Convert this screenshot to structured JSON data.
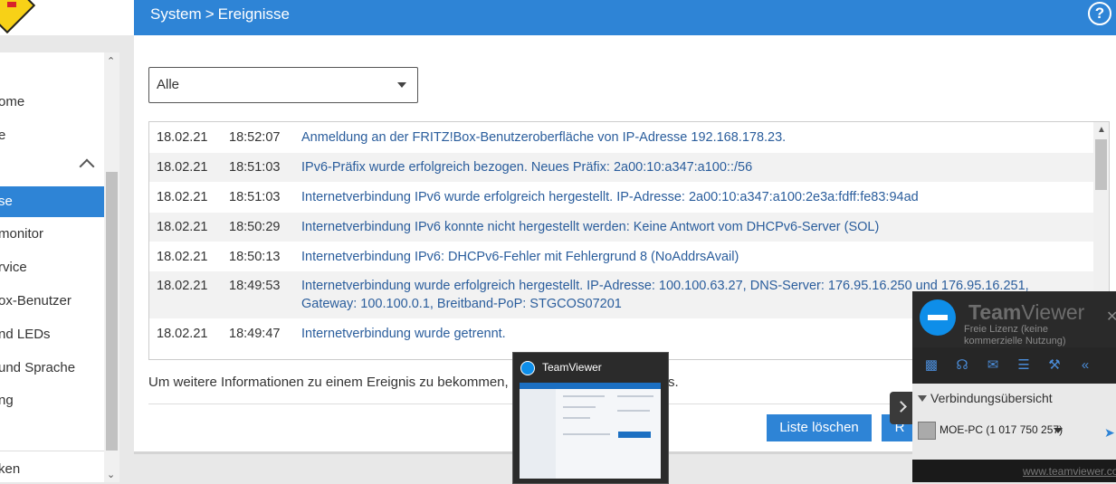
{
  "header": {
    "breadcrumb": [
      "System",
      "Ereignisse"
    ],
    "breadcrumb_separator": ">",
    "help_label": "?"
  },
  "sidebar": {
    "items": [
      {
        "label": "ome"
      },
      {
        "label": "e"
      },
      {
        "label": "se",
        "active": true
      },
      {
        "label": "monitor"
      },
      {
        "label": "rvice"
      },
      {
        "label": "ox-Benutzer"
      },
      {
        "label": "nd LEDs"
      },
      {
        "label": "und Sprache"
      },
      {
        "label": "ng"
      },
      {
        "label": "ken"
      }
    ]
  },
  "filter": {
    "selected": "Alle"
  },
  "events": [
    {
      "date": "18.02.21",
      "time": "18:52:07",
      "message": "Anmeldung an der FRITZ!Box-Benutzeroberfläche von IP-Adresse 192.168.178.23."
    },
    {
      "date": "18.02.21",
      "time": "18:51:03",
      "message": "IPv6-Präfix wurde erfolgreich bezogen. Neues Präfix: 2a00:10:a347:a100::/56"
    },
    {
      "date": "18.02.21",
      "time": "18:51:03",
      "message": "Internetverbindung IPv6 wurde erfolgreich hergestellt. IP-Adresse: 2a00:10:a347:a100:2e3a:fdff:fe83:94ad"
    },
    {
      "date": "18.02.21",
      "time": "18:50:29",
      "message": "Internetverbindung IPv6 konnte nicht hergestellt werden: Keine Antwort vom DHCPv6-Server (SOL)"
    },
    {
      "date": "18.02.21",
      "time": "18:50:13",
      "message": "Internetverbindung IPv6: DHCPv6-Fehler mit Fehlergrund 8 (NoAddrsAvail)"
    },
    {
      "date": "18.02.21",
      "time": "18:49:53",
      "message": "Internetverbindung wurde erfolgreich hergestellt. IP-Adresse: 100.100.63.27, DNS-Server: 176.95.16.250 und 176.95.16.251, Gateway: 100.100.0.1, Breitband-PoP: STGCOS07201"
    },
    {
      "date": "18.02.21",
      "time": "18:49:47",
      "message": "Internetverbindung wurde getrennt."
    }
  ],
  "info_text": "Um weitere Informationen zu einem Ereignis zu bekommen,",
  "info_tail": "s.",
  "buttons": {
    "clear": "Liste löschen",
    "second": "R"
  },
  "teamviewer_thumbnail": {
    "title": "TeamViewer"
  },
  "teamviewer_panel": {
    "brand_bold": "Team",
    "brand_light": "Viewer",
    "license": "Freie Lizenz (keine kommerzielle Nutzung)",
    "section_title": "Verbindungsübersicht",
    "pc_name": "MOE-PC (1 017 750 257)",
    "link": "www.teamviewer.co"
  },
  "colors": {
    "accent": "#2e84d6",
    "link": "#2a5d9c",
    "teamviewer_blue": "#0e8ee9"
  }
}
